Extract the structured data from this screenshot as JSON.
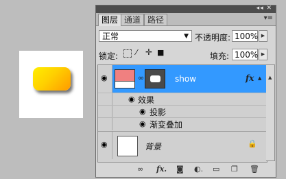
{
  "panel": {
    "title_icons": "◂◂ ✕",
    "tabs": [
      "图层",
      "通道",
      "路径"
    ],
    "menu_icon": "▾≡"
  },
  "blend": {
    "mode": "正常",
    "opacity_label": "不透明度:",
    "opacity_value": "100%"
  },
  "lock": {
    "label": "锁定:",
    "fill_label": "填充:",
    "fill_value": "100%"
  },
  "layers": {
    "show": {
      "name": "show",
      "fx": "fx"
    },
    "effects_label": "效果",
    "effects": [
      "投影",
      "渐变叠加"
    ],
    "background": {
      "name": "背景"
    }
  },
  "icons": {
    "eye": "eye-icon",
    "chain": "chain-icon",
    "lock": "lock-icon"
  },
  "bottom": [
    "link-icon",
    "fx-icon",
    "mask-icon",
    "adjustment-icon",
    "folder-icon",
    "new-layer-icon",
    "trash-icon"
  ]
}
